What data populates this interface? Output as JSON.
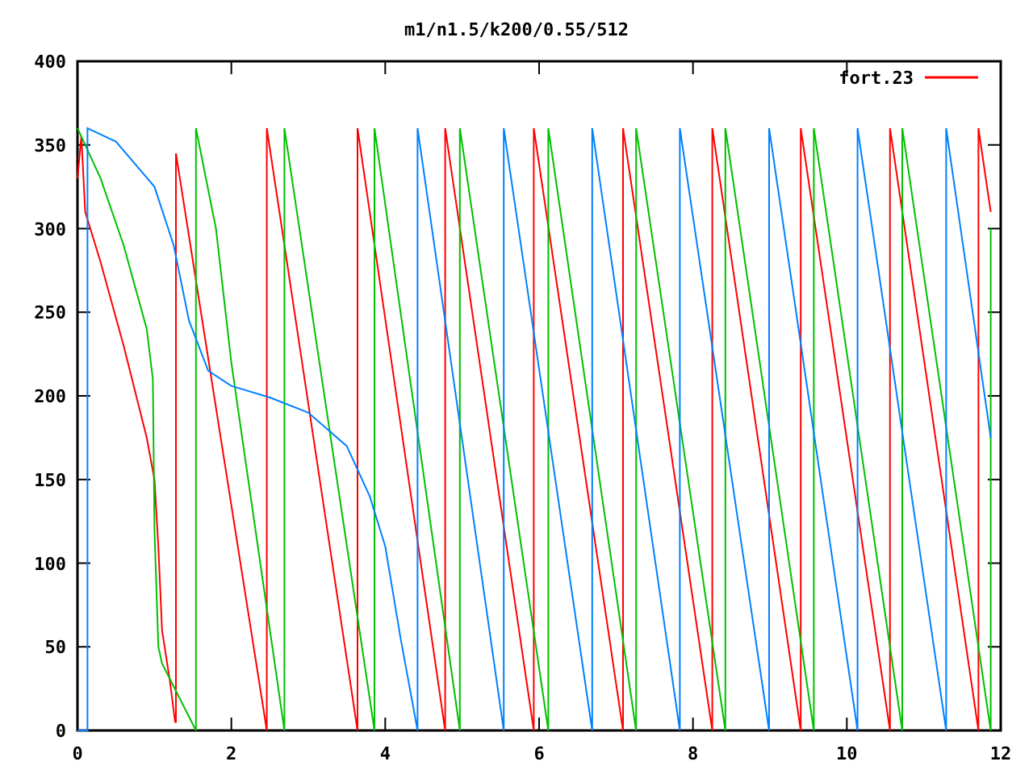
{
  "plot": {
    "chart_data": {
      "type": "line",
      "title": "m1/n1.5/k200/0.55/512",
      "xlim": [
        0,
        12
      ],
      "ylim": [
        0,
        400
      ],
      "xticks": [
        0,
        2,
        4,
        6,
        8,
        10,
        12
      ],
      "yticks": [
        0,
        50,
        100,
        150,
        200,
        250,
        300,
        350,
        400
      ],
      "series": [
        {
          "name": "fort.23",
          "color": "#ff0000",
          "x": [
            0,
            0.05,
            0.1,
            0.3,
            0.6,
            0.9,
            1.0,
            1.05,
            1.1,
            1.2,
            1.27,
            1.28,
            1.28,
            2.46,
            2.46,
            3.64,
            3.64,
            4.78,
            4.78,
            5.93,
            5.93,
            7.09,
            7.09,
            8.25,
            8.25,
            9.4,
            9.4,
            10.56,
            10.56,
            11.71,
            11.71,
            11.87
          ],
          "values": [
            330,
            355,
            310,
            280,
            230,
            175,
            150,
            110,
            60,
            30,
            5,
            5,
            345,
            0,
            360,
            0,
            360,
            0,
            360,
            0,
            360,
            0,
            360,
            0,
            360,
            0,
            360,
            0,
            360,
            0,
            360,
            310
          ]
        },
        {
          "color": "#00c000",
          "x": [
            0,
            0.3,
            0.6,
            0.9,
            0.98,
            1.0,
            1.05,
            1.1,
            1.54,
            1.54,
            1.8,
            2.0,
            2.69,
            2.69,
            3.86,
            3.86,
            4.97,
            4.97,
            6.12,
            6.12,
            7.26,
            7.26,
            8.42,
            8.42,
            9.57,
            9.57,
            10.72,
            10.72,
            11.87,
            11.87
          ],
          "values": [
            360,
            330,
            290,
            240,
            210,
            120,
            50,
            40,
            0,
            360,
            300,
            220,
            0,
            360,
            0,
            360,
            0,
            360,
            0,
            360,
            0,
            360,
            0,
            360,
            0,
            360,
            0,
            360,
            0,
            300
          ]
        },
        {
          "color": "#0080ff",
          "x": [
            0,
            0.13,
            0.13,
            0.5,
            1.0,
            1.25,
            1.45,
            1.7,
            2.0,
            2.5,
            3.0,
            3.5,
            3.8,
            4.0,
            4.2,
            4.42,
            4.42,
            5.54,
            5.54,
            6.69,
            6.69,
            7.83,
            7.83,
            8.99,
            8.99,
            10.14,
            10.14,
            11.29,
            11.29,
            11.87
          ],
          "values": [
            0,
            0,
            360,
            352,
            325,
            290,
            245,
            215,
            206,
            199,
            190,
            170,
            140,
            110,
            55,
            0,
            360,
            0,
            360,
            0,
            360,
            0,
            360,
            0,
            360,
            0,
            360,
            0,
            360,
            175
          ]
        }
      ]
    }
  }
}
